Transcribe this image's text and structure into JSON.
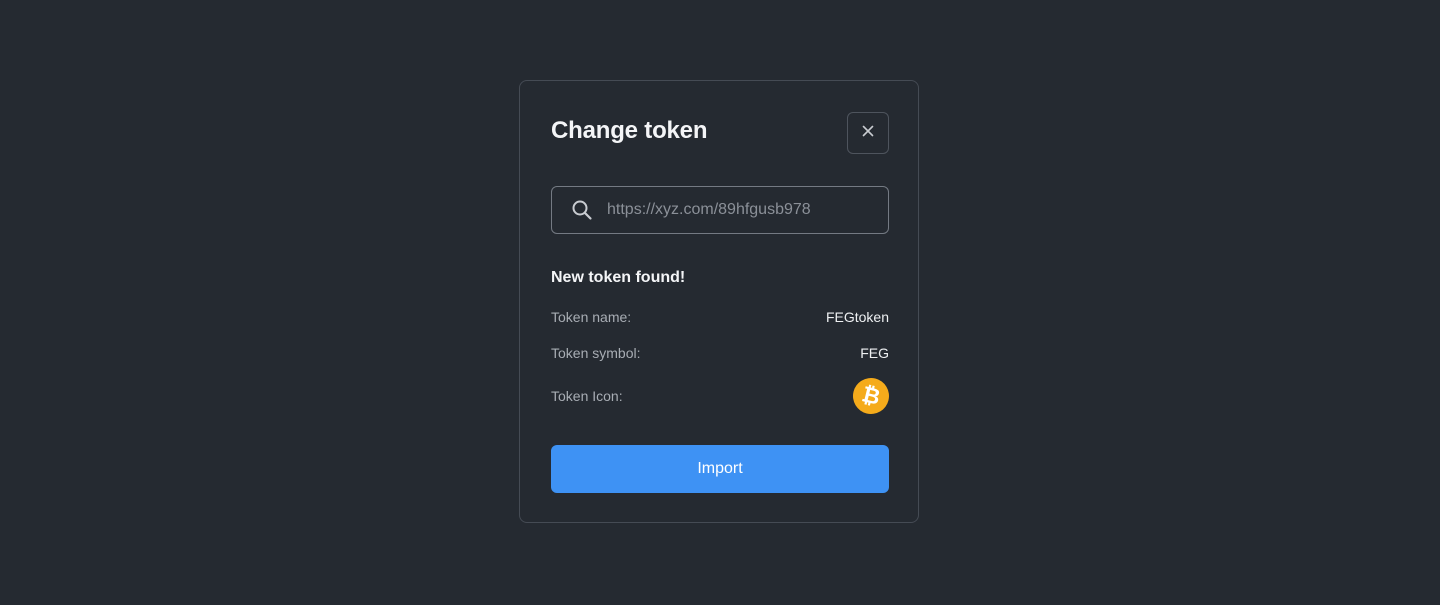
{
  "modal": {
    "title": "Change token",
    "close_icon": "close-icon"
  },
  "search": {
    "icon": "search-icon",
    "value": "https://xyz.com/89hfgusb978",
    "placeholder": "https://xyz.com/89hfgusb978"
  },
  "result": {
    "heading": "New token found!",
    "rows": [
      {
        "label": "Token name:",
        "value": "FEGtoken"
      },
      {
        "label": "Token symbol:",
        "value": "FEG"
      },
      {
        "label": "Token Icon:",
        "icon": "bitcoin-icon",
        "icon_glyph": "₿"
      }
    ]
  },
  "actions": {
    "import_label": "Import"
  },
  "colors": {
    "background": "#252a31",
    "border": "#454b54",
    "accent": "#3e92f4",
    "token_icon": "#f5ab1b"
  }
}
